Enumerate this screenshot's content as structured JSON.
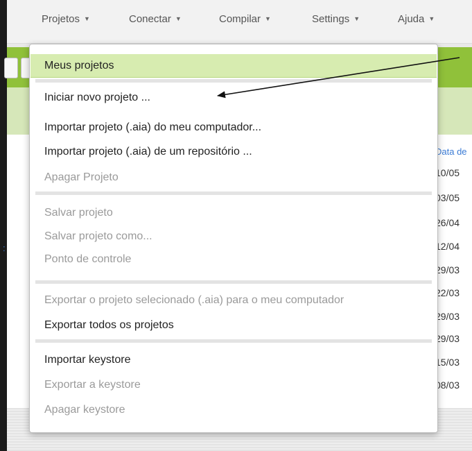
{
  "menubar": {
    "items": [
      {
        "label": "Projetos"
      },
      {
        "label": "Conectar"
      },
      {
        "label": "Compilar"
      },
      {
        "label": "Settings"
      },
      {
        "label": "Ajuda"
      }
    ]
  },
  "projects_menu": {
    "items": [
      {
        "label": "Meus projetos",
        "state": "highlighted"
      },
      {
        "label": "Iniciar novo projeto ...",
        "state": "enabled"
      },
      {
        "label": "Importar projeto (.aia) do meu computador...",
        "state": "enabled"
      },
      {
        "label": "Importar projeto (.aia) de um repositório ...",
        "state": "enabled"
      },
      {
        "label": "Apagar Projeto",
        "state": "disabled"
      },
      {
        "label": "Salvar projeto",
        "state": "disabled"
      },
      {
        "label": "Salvar projeto como...",
        "state": "disabled"
      },
      {
        "label": "Ponto de controle",
        "state": "disabled"
      },
      {
        "label": "Exportar o projeto selecionado (.aia) para o meu computador",
        "state": "disabled"
      },
      {
        "label": "Exportar todos os projetos",
        "state": "enabled"
      },
      {
        "label": "Importar keystore",
        "state": "enabled"
      },
      {
        "label": "Exportar a keystore",
        "state": "disabled"
      },
      {
        "label": "Apagar keystore",
        "state": "disabled"
      }
    ]
  },
  "project_list": {
    "date_column_header": "Data de",
    "dates": [
      "10/05",
      "03/05",
      "26/04",
      "12/04",
      "29/03",
      "22/03",
      "29/03",
      "29/03",
      "15/03",
      "08/03"
    ]
  },
  "colors": {
    "toolbar_green": "#90c13a",
    "highlight_green": "#d7ecb0",
    "disabled_text": "#9a9a9a"
  }
}
